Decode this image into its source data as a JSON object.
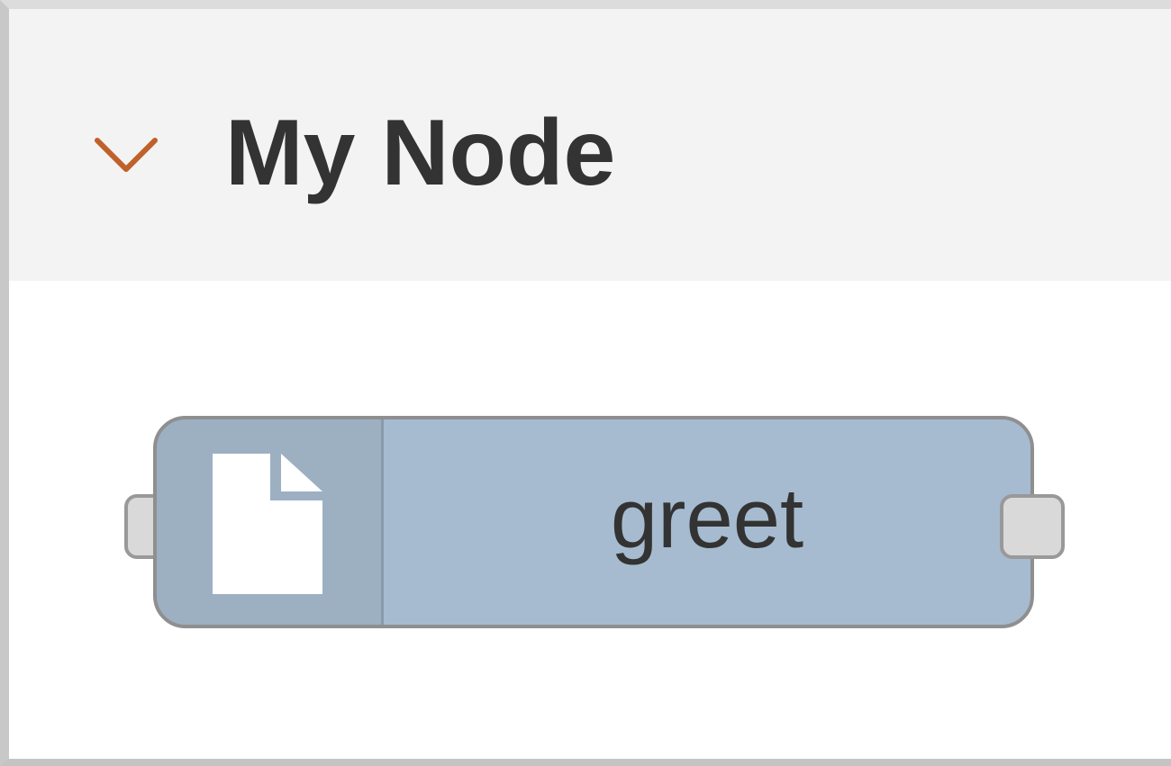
{
  "category": {
    "title": "My Node",
    "expanded": true,
    "toggle_icon": "chevron-down-icon"
  },
  "node": {
    "label": "greet",
    "icon": "file-icon",
    "color": "#a6bbcf",
    "inputs": 1,
    "outputs": 1
  },
  "colors": {
    "header_background": "#f3f3f3",
    "chevron": "#c0602a",
    "port_fill": "#d9d9d9"
  }
}
